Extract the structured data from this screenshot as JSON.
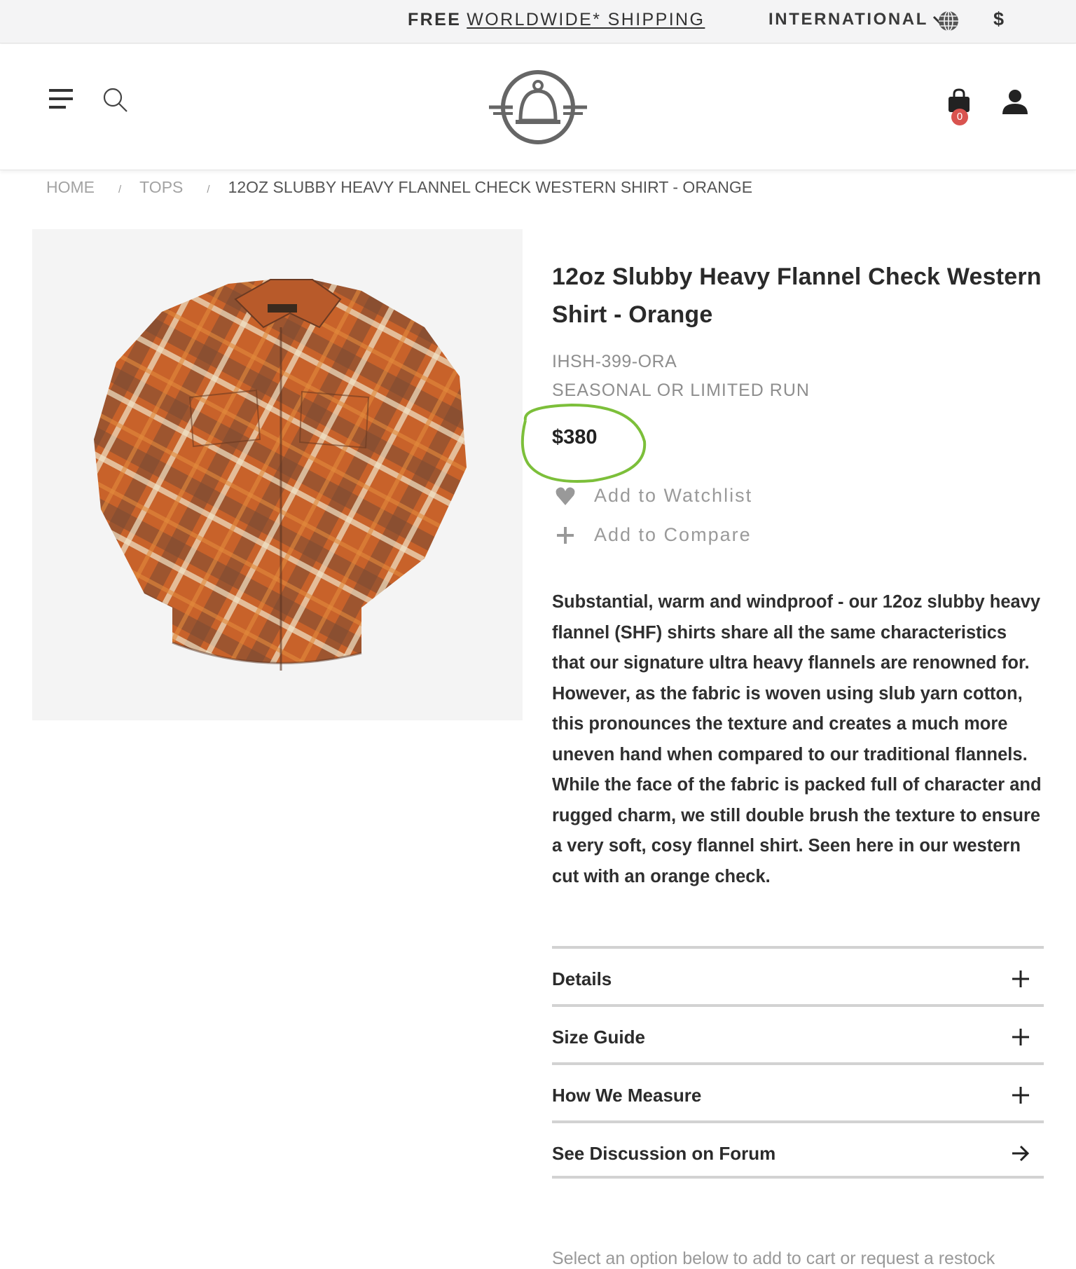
{
  "topbar": {
    "promo_free": "FREE",
    "promo_shipping": "WORLDWIDE* SHIPPING",
    "region": "INTERNATIONAL",
    "region_icon": "chevron-down-icon",
    "currency": "$"
  },
  "header": {
    "menu_icon": "hamburger-menu-icon",
    "search_icon": "search-icon",
    "logo_icon": "winged-bell-logo",
    "cart_count": "0",
    "account_icon": "user-icon"
  },
  "breadcrumb": {
    "items": [
      "HOME",
      "TOPS"
    ],
    "separator": "/",
    "current": "12OZ SLUBBY HEAVY FLANNEL CHECK WESTERN SHIRT - ORANGE"
  },
  "product": {
    "title": "12oz Slubby Heavy Flannel Check Western Shirt - Orange",
    "sku": "IHSH-399-ORA",
    "run_type": "SEASONAL OR LIMITED RUN",
    "price": "$380",
    "watchlist_label": "Add to Watchlist",
    "compare_label": "Add to Compare",
    "description": "Substantial, warm and windproof - our 12oz slubby heavy flannel (SHF) shirts share all the same characteristics that our signature ultra heavy flannels are renowned for. However, as the fabric is woven using slub yarn cotton, this pronounces the texture and creates a much more uneven hand when compared to our traditional flannels. While the face of the fabric is packed full of character and rugged charm, we still double brush the texture to ensure a very soft, cosy flannel shirt. Seen here in our western cut with an orange check."
  },
  "accordion": [
    {
      "label": "Details",
      "icon": "plus-icon"
    },
    {
      "label": "Size Guide",
      "icon": "plus-icon"
    },
    {
      "label": "How We Measure",
      "icon": "plus-icon"
    },
    {
      "label": "See Discussion on Forum",
      "icon": "arrow-right-icon"
    }
  ],
  "restock_text": "Select an option below to add to cart or request a restock",
  "colors": {
    "annotation": "#7cbf3a",
    "badge": "#d9534f",
    "shirt_orange": "#c8622a"
  }
}
